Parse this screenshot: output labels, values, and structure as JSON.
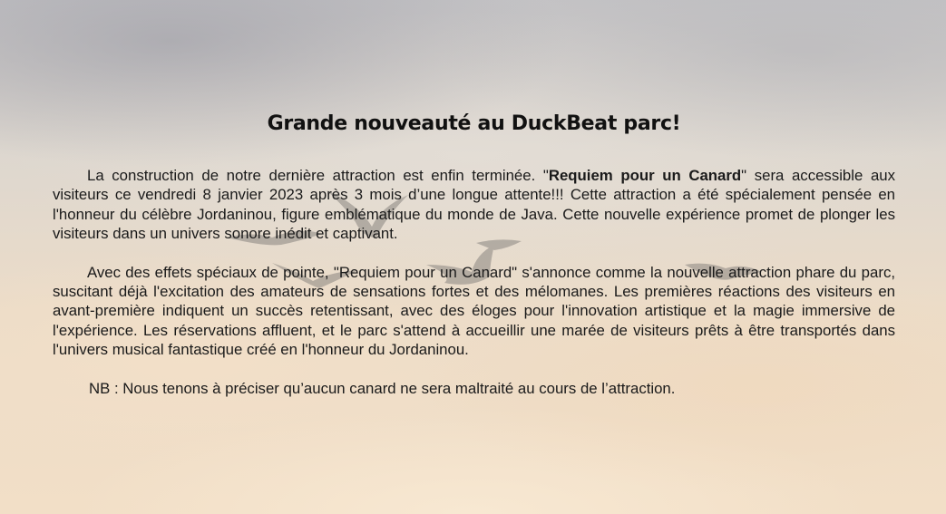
{
  "article": {
    "title": "Grande nouveauté au DuckBeat parc!",
    "p1": {
      "before": "La construction de notre dernière attraction est enfin terminée. \"",
      "bold": "Requiem pour un Canard",
      "after": "\" sera accessible aux visiteurs ce vendredi 8 janvier 2023 après 3 mois d’une longue attente!!! Cette attraction a été spécialement pensée en l'honneur du célèbre Jordaninou, figure emblématique du monde de Java. Cette nouvelle expérience promet de plonger les visiteurs dans un univers sonore inédit et captivant."
    },
    "p2": "Avec des effets spéciaux de pointe, \"Requiem pour un Canard\" s'annonce comme la nouvelle attraction phare du parc, suscitant déjà l'excitation des amateurs de sensations fortes et des mélomanes. Les premières réactions des visiteurs en avant-première indiquent un succès retentissant, avec des éloges pour l'innovation artistique et la magie immersive de l'expérience. Les réservations affluent, et le parc s'attend à accueillir une marée de visiteurs prêts à être transportés dans l'univers musical fantastique créé en l'honneur du Jordaninou.",
    "p3": "NB : Nous tenons à préciser qu’aucun canard ne sera maltraité au cours de l’attraction."
  }
}
